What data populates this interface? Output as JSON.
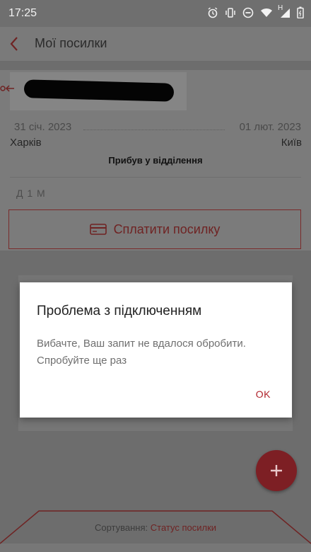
{
  "status_bar": {
    "time": "17:25",
    "network_label": "H"
  },
  "app_bar": {
    "title": "Мої посилки"
  },
  "parcel": {
    "date_from": "31 січ. 2023",
    "date_to": "01 лют. 2023",
    "city_from": "Харків",
    "city_to": "Київ",
    "status": "Прибув у відділення",
    "package_type": "Д 1 М",
    "pay_button_label": "Сплатити посилку"
  },
  "sort": {
    "label": "Сортування: ",
    "value": "Статус посилки"
  },
  "dialog": {
    "title": "Проблема з підключенням",
    "message": "Вибачте, Ваш запит не вдалося обробити. Спробуйте ще раз",
    "ok_label": "OK"
  },
  "colors": {
    "accent": "#b0232b",
    "dim_background": "#777777",
    "dialog_background": "#ffffff"
  },
  "icons": [
    "alarm-icon",
    "vibrate-icon",
    "dnd-icon",
    "wifi-icon",
    "signal-icon",
    "battery-icon",
    "back-arrow-icon",
    "card-icon",
    "plus-icon"
  ]
}
